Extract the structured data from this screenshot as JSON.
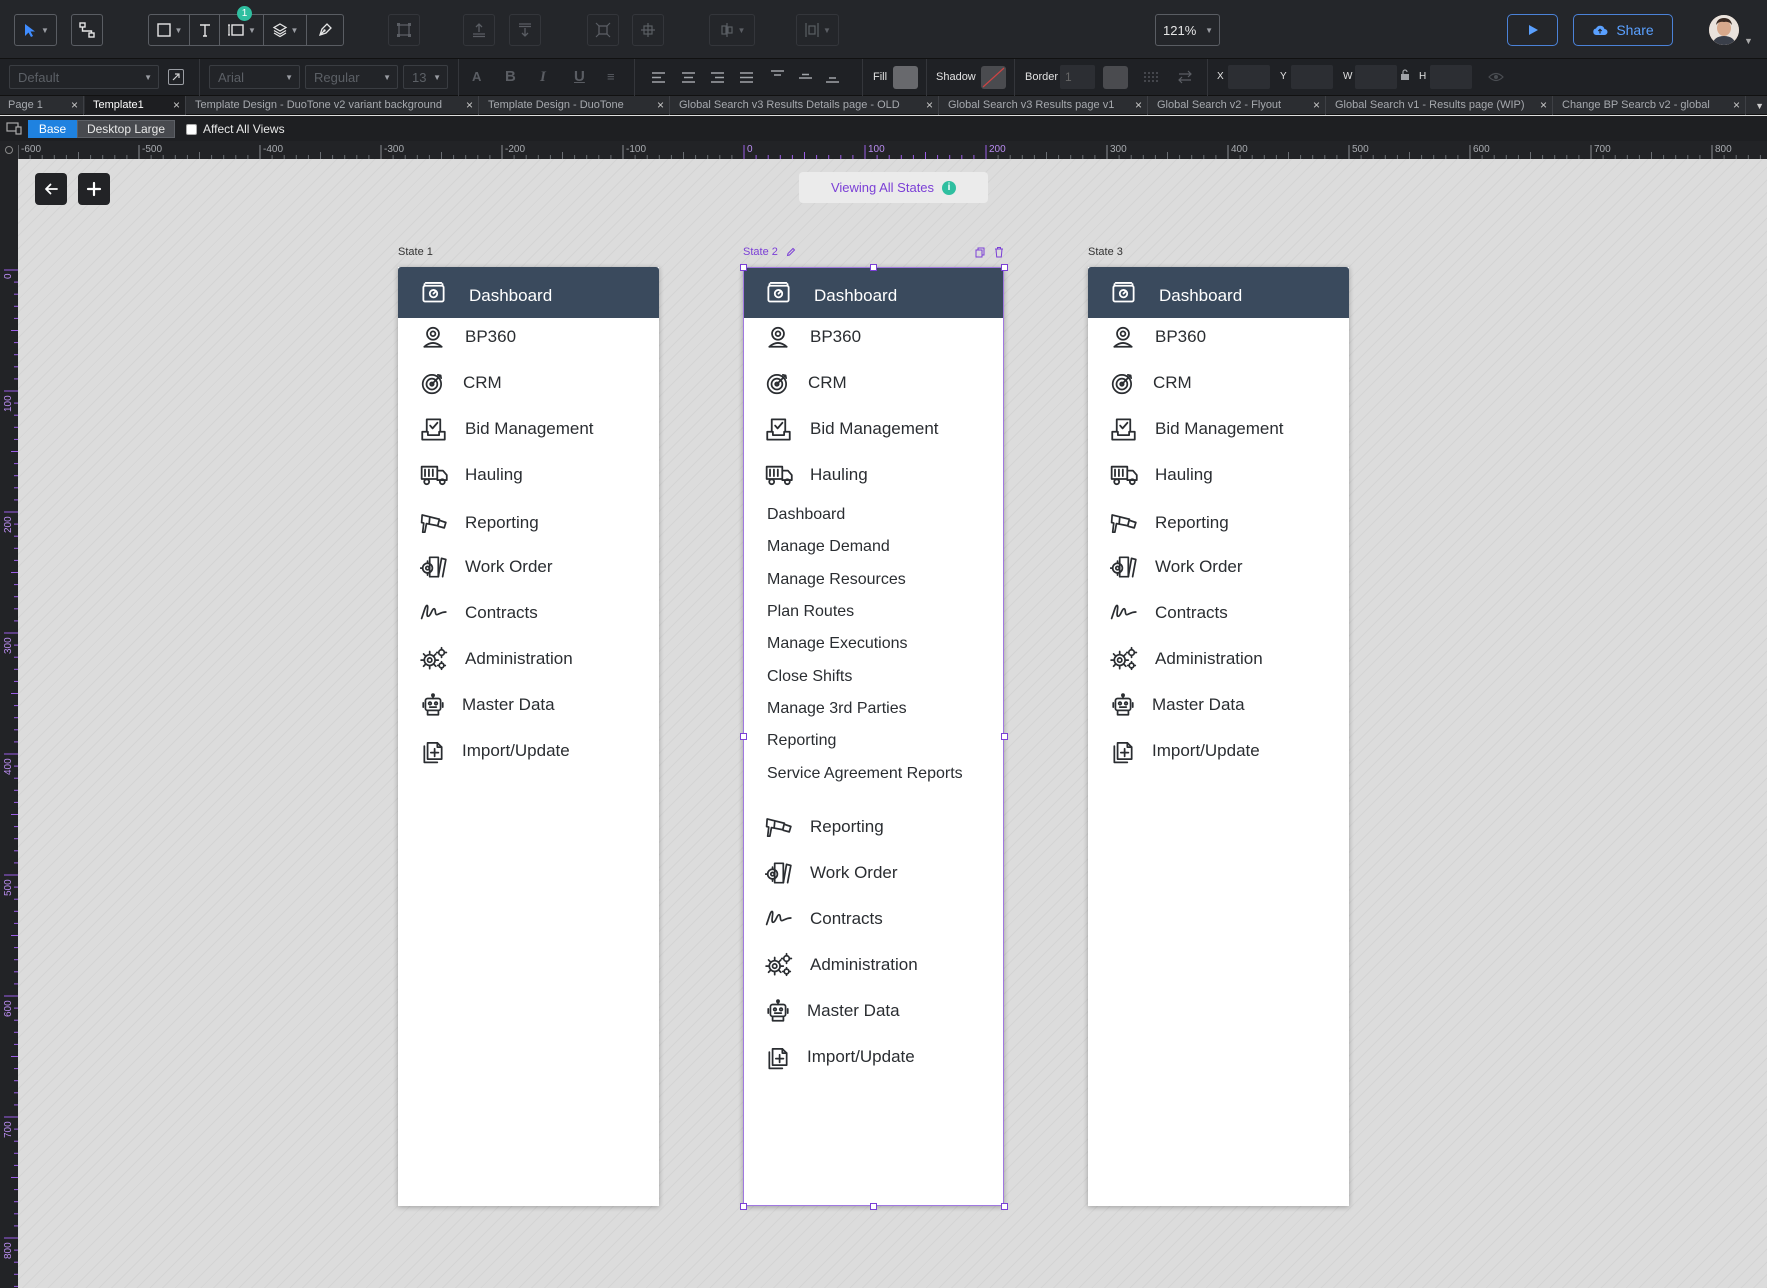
{
  "toolbar": {
    "badge": "1",
    "zoom": "121%",
    "share_label": "Share"
  },
  "properties": {
    "style_select": "Default",
    "font_family": "Arial",
    "font_weight": "Regular",
    "font_size": "13",
    "fill_label": "Fill",
    "shadow_label": "Shadow",
    "border_label": "Border",
    "border_value": "1",
    "x_label": "X",
    "y_label": "Y",
    "w_label": "W",
    "h_label": "H",
    "fill_color": "#68696d"
  },
  "tabs": [
    {
      "label": "Page 1"
    },
    {
      "label": "Template1",
      "active": true
    },
    {
      "label": "Template Design - DuoTone v2 variant background"
    },
    {
      "label": "Template Design - DuoTone"
    },
    {
      "label": "Global Search v3 Results Details page - OLD"
    },
    {
      "label": "Global Search v3 Results page v1"
    },
    {
      "label": "Global Search v2 - Flyout"
    },
    {
      "label": "Global Search v1 - Results page (WIP)"
    },
    {
      "label": "Change BP Searcb v2 - global"
    }
  ],
  "views": {
    "base": "Base",
    "desktop_large": "Desktop Large",
    "affect_all_views": "Affect All Views"
  },
  "ruler": {
    "top_ticks": [
      "-600",
      "-500",
      "-400",
      "-300",
      "-200",
      "-100",
      "0",
      "100",
      "200",
      "300",
      "400",
      "500",
      "600",
      "700",
      "800"
    ],
    "left_ticks": [
      "0",
      "100",
      "200",
      "300",
      "400",
      "500",
      "600",
      "700",
      "800"
    ]
  },
  "canvas": {
    "viewing_label": "Viewing All States",
    "viewing_badge": "i"
  },
  "states": [
    {
      "label": "State 1",
      "header": "Dashboard",
      "items": [
        "BP360",
        "CRM",
        "Bid Management",
        "Hauling",
        "Reporting",
        "Work Order",
        "Contracts",
        "Administration",
        "Master Data",
        "Import/Update"
      ]
    },
    {
      "label": "State 2",
      "header": "Dashboard",
      "items": [
        "BP360",
        "CRM",
        "Bid Management",
        "Hauling"
      ],
      "submenu": [
        "Dashboard",
        "Manage Demand",
        "Manage Resources",
        "Plan Routes",
        "Manage Executions",
        "Close Shifts",
        "Manage 3rd Parties",
        "Reporting",
        "Service Agreement Reports"
      ],
      "items_after": [
        "Reporting",
        "Work Order",
        "Contracts",
        "Administration",
        "Master Data",
        "Import/Update"
      ]
    },
    {
      "label": "State 3",
      "header": "Dashboard",
      "items": [
        "BP360",
        "CRM",
        "Bid Management",
        "Hauling",
        "Reporting",
        "Work Order",
        "Contracts",
        "Administration",
        "Master Data",
        "Import/Update"
      ]
    }
  ],
  "colors": {
    "nav_header": "#3a4a5d",
    "accent_purple": "#7b3fd6",
    "accent_blue": "#1f82e0",
    "badge_teal": "#2fbfa0"
  }
}
